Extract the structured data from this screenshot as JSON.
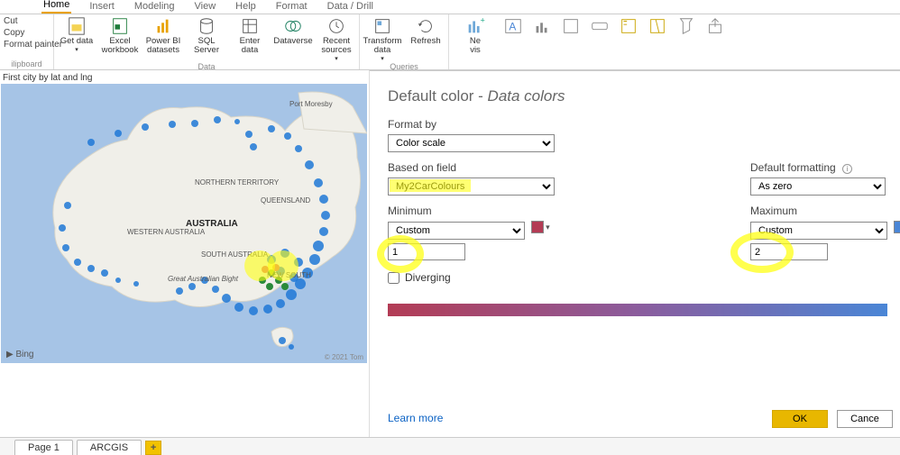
{
  "menu_tabs": {
    "home": "Home",
    "insert": "Insert",
    "modeling": "Modeling",
    "view": "View",
    "help": "Help",
    "format": "Format",
    "data_drill": "Data / Drill"
  },
  "ribbon": {
    "clipboard": {
      "label": "ilipboard",
      "cut": "Cut",
      "copy": "Copy",
      "format_painter": "Format painter"
    },
    "data": {
      "label": "Data",
      "get_data": "Get data",
      "excel": "Excel workbook",
      "pbi_ds": "Power BI datasets",
      "sql": "SQL Server",
      "enter": "Enter data",
      "dataverse": "Dataverse",
      "recent": "Recent sources"
    },
    "queries": {
      "label": "Queries",
      "transform": "Transform data",
      "refresh": "Refresh"
    },
    "insert": {
      "new_visual": "Ne\nvis"
    }
  },
  "map": {
    "title": "First city by lat and lng",
    "labels": {
      "australia": "AUSTRALIA",
      "wa": "WESTERN AUSTRALIA",
      "nt": "NORTHERN TERRITORY",
      "qld": "QUEENSLAND",
      "sa": "SOUTH AUSTRALIA",
      "nsw": "NEW SOUTH",
      "bight": "Great Australian Bight",
      "moresby": "Port Moresby"
    },
    "attrib_left": "▶ Bing",
    "attrib_right": "© 2021 Tom"
  },
  "panel": {
    "title_a": "Default color - ",
    "title_b": "Data colors",
    "format_by": {
      "label": "Format by",
      "value": "Color scale"
    },
    "based_on": {
      "label": "Based on field",
      "value": "My2CarColours"
    },
    "default_formatting": {
      "label": "Default formatting",
      "value": "As zero"
    },
    "minimum": {
      "label": "Minimum",
      "mode": "Custom",
      "value": "1",
      "color": "#b33c55"
    },
    "maximum": {
      "label": "Maximum",
      "mode": "Custom",
      "value": "2",
      "color": "#4a86d6"
    },
    "diverging": "Diverging",
    "learn_more": "Learn more",
    "ok": "OK",
    "cancel": "Cance"
  },
  "page_tabs": {
    "p1": "Page 1",
    "p2": "ARCGIS",
    "add": "+"
  }
}
